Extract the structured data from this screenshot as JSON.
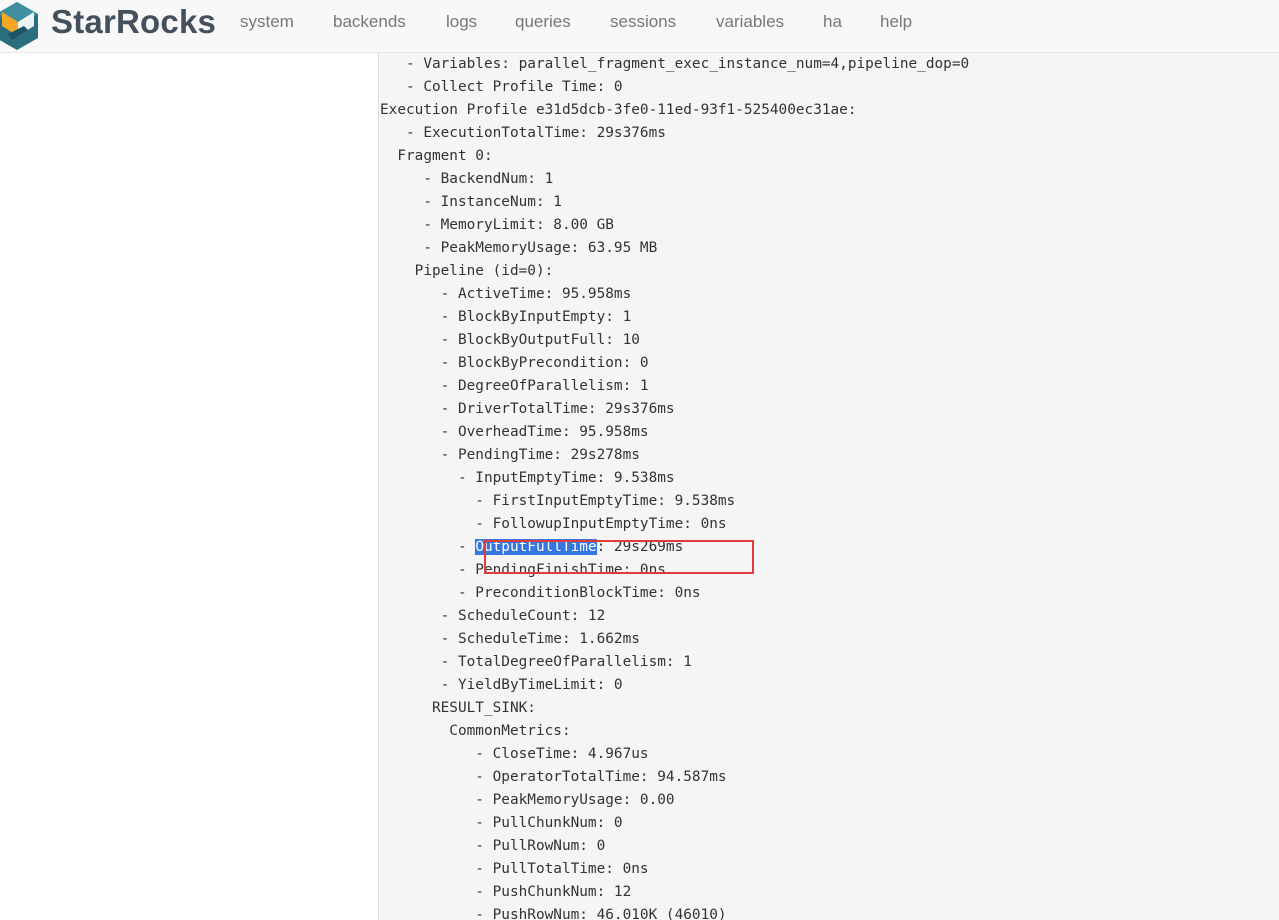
{
  "brand": {
    "name": "StarRocks"
  },
  "nav": {
    "items": [
      "system",
      "backends",
      "logs",
      "queries",
      "sessions",
      "variables",
      "ha",
      "help"
    ]
  },
  "profile": {
    "lines": [
      "   - Variables: parallel_fragment_exec_instance_num=4,pipeline_dop=0",
      "   - Collect Profile Time: 0",
      "Execution Profile e31d5dcb-3fe0-11ed-93f1-525400ec31ae:",
      "   - ExecutionTotalTime: 29s376ms",
      "  Fragment 0:",
      "     - BackendNum: 1",
      "     - InstanceNum: 1",
      "     - MemoryLimit: 8.00 GB",
      "     - PeakMemoryUsage: 63.95 MB",
      "    Pipeline (id=0):",
      "       - ActiveTime: 95.958ms",
      "       - BlockByInputEmpty: 1",
      "       - BlockByOutputFull: 10",
      "       - BlockByPrecondition: 0",
      "       - DegreeOfParallelism: 1",
      "       - DriverTotalTime: 29s376ms",
      "       - OverheadTime: 95.958ms",
      "       - PendingTime: 29s278ms",
      "         - InputEmptyTime: 9.538ms",
      "           - FirstInputEmptyTime: 9.538ms",
      "           - FollowupInputEmptyTime: 0ns",
      "         - OutputFullTime: 29s269ms",
      "         - PendingFinishTime: 0ns",
      "         - PreconditionBlockTime: 0ns",
      "       - ScheduleCount: 12",
      "       - ScheduleTime: 1.662ms",
      "       - TotalDegreeOfParallelism: 1",
      "       - YieldByTimeLimit: 0",
      "      RESULT_SINK:",
      "        CommonMetrics:",
      "           - CloseTime: 4.967us",
      "           - OperatorTotalTime: 94.587ms",
      "           - PeakMemoryUsage: 0.00",
      "           - PullChunkNum: 0",
      "           - PullRowNum: 0",
      "           - PullTotalTime: 0ns",
      "           - PushChunkNum: 12",
      "           - PushRowNum: 46.010K (46010)"
    ],
    "selected_line_index": 21,
    "selected_prefix": "         - ",
    "selected_text": "OutputFullTime",
    "selected_suffix": ": 29s269ms"
  },
  "colors": {
    "navbar_bg": "#f8f8f8",
    "nav_text": "#777777",
    "brand_text": "#44505d",
    "logo_teal": "#2b6e7d",
    "logo_orange": "#f5a623",
    "pre_bg": "#f5f5f5",
    "selection_bg": "#3477e0",
    "annotation_red": "#e23b3b"
  }
}
